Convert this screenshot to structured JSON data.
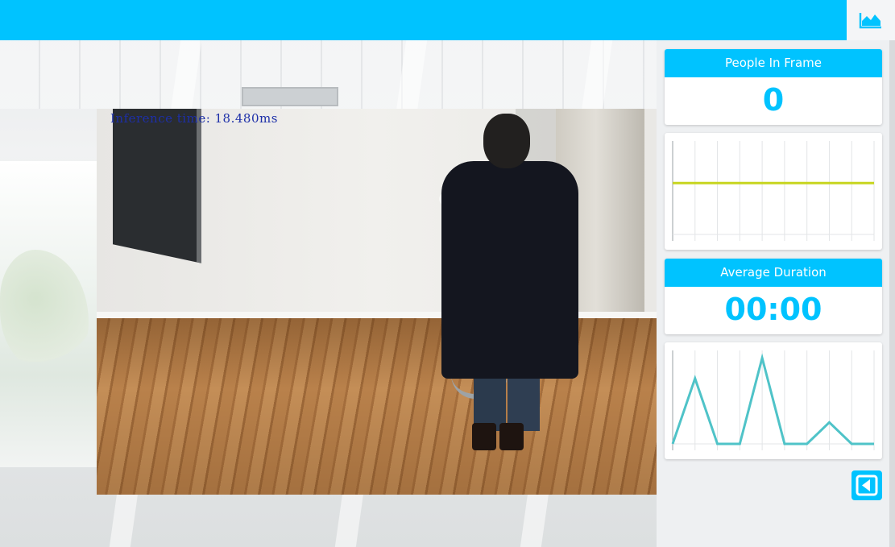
{
  "colors": {
    "accent": "#00c3ff",
    "people_line": "#c7d51f",
    "duration_line": "#4fc3c8"
  },
  "icons": {
    "stats_toggle": "area-chart-icon",
    "collapse": "caret-left-icon"
  },
  "video": {
    "inference_text": "Inference time: 18.480ms"
  },
  "panel": {
    "people": {
      "title": "People In Frame",
      "value": "0"
    },
    "duration": {
      "title": "Average Duration",
      "value": "00:00"
    }
  },
  "chart_data": [
    {
      "type": "line",
      "series": [
        {
          "values": [
            0.55,
            0.55,
            0.55,
            0.55,
            0.55,
            0.55,
            0.55,
            0.55,
            0.55,
            0.55
          ]
        }
      ]
    },
    {
      "type": "line",
      "series": [
        {
          "values": [
            0.0,
            0.7,
            0.0,
            0.0,
            0.92,
            0.0,
            0.0,
            0.23,
            0.0,
            0.0
          ]
        }
      ]
    }
  ]
}
